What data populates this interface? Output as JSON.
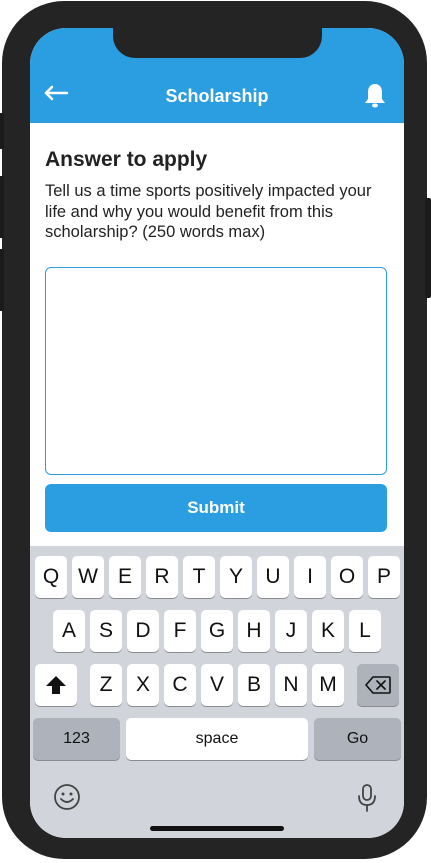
{
  "header": {
    "title": "Scholarship",
    "back_icon": "arrow-left-icon",
    "notification_icon": "bell-icon",
    "color": "#2b9ee2"
  },
  "content": {
    "heading": "Answer to apply",
    "question": "Tell us a time sports positively impacted your life and why you would benefit from this scholarship? (250 words max)",
    "answer_value": "",
    "submit_label": "Submit"
  },
  "keyboard": {
    "row1": [
      "Q",
      "W",
      "E",
      "R",
      "T",
      "Y",
      "U",
      "I",
      "O",
      "P"
    ],
    "row2": [
      "A",
      "S",
      "D",
      "F",
      "G",
      "H",
      "J",
      "K",
      "L"
    ],
    "row3": [
      "Z",
      "X",
      "C",
      "V",
      "B",
      "N",
      "M"
    ],
    "numbers_label": "123",
    "space_label": "space",
    "go_label": "Go",
    "shift_icon": "shift-icon",
    "backspace_icon": "backspace-icon",
    "emoji_icon": "emoji-icon",
    "mic_icon": "microphone-icon"
  }
}
